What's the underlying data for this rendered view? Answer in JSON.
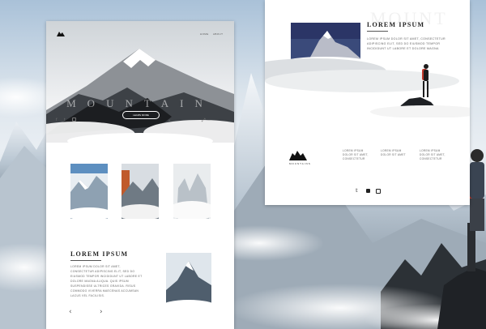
{
  "page1": {
    "nav": [
      "HOME",
      "ABOUT"
    ],
    "hero_word": "MOUNTAIN",
    "hero_button": "LEARN MORE",
    "hero_icons": [
      "facebook-icon",
      "twitter-icon",
      "instagram-icon"
    ],
    "section": {
      "title": "LOREM IPSUM",
      "text": "LOREM IPSUM DOLOR SIT AMET, CONSECTETUR ADIPISCING ELIT, SED DO EIUSMOD TEMPOR INCIDIDUNT UT LABORE ET DOLORE MAGNA ALIQUA. QUIS IPSUM SUSPENDISSE ULTRICES GRAVIDA. RISUS COMMODO VIVERRA MAECENAS ACCUMSAN LACUS VEL FACILISIS."
    },
    "arrows": {
      "prev": "‹",
      "next": "›"
    }
  },
  "page2": {
    "watermark": "MOUNT",
    "title": "LOREM IPSUM",
    "text": "LOREM IPSUM DOLOR SIT AMET, CONSECTETUR ADIPISCING ELIT, SED DO EIUSMOD TEMPOR INCIDIDUNT UT LABORE ET DOLORE MAGNA",
    "footer_logo_text": "MOUNTAINS",
    "footer_cols": [
      "LOREM IPSUM DOLOR SIT AMET, CONSECTETUR",
      "LOREM IPSUM DOLOR SIT AMET",
      "LOREM IPSUM DOLOR SIT AMET, CONSECTETUR"
    ],
    "social_icons": [
      "twitter-icon",
      "facebook-icon",
      "instagram-icon"
    ]
  },
  "colors": {
    "sky": "#a9c1d8",
    "paper": "#ffffff",
    "ink": "#222222"
  }
}
